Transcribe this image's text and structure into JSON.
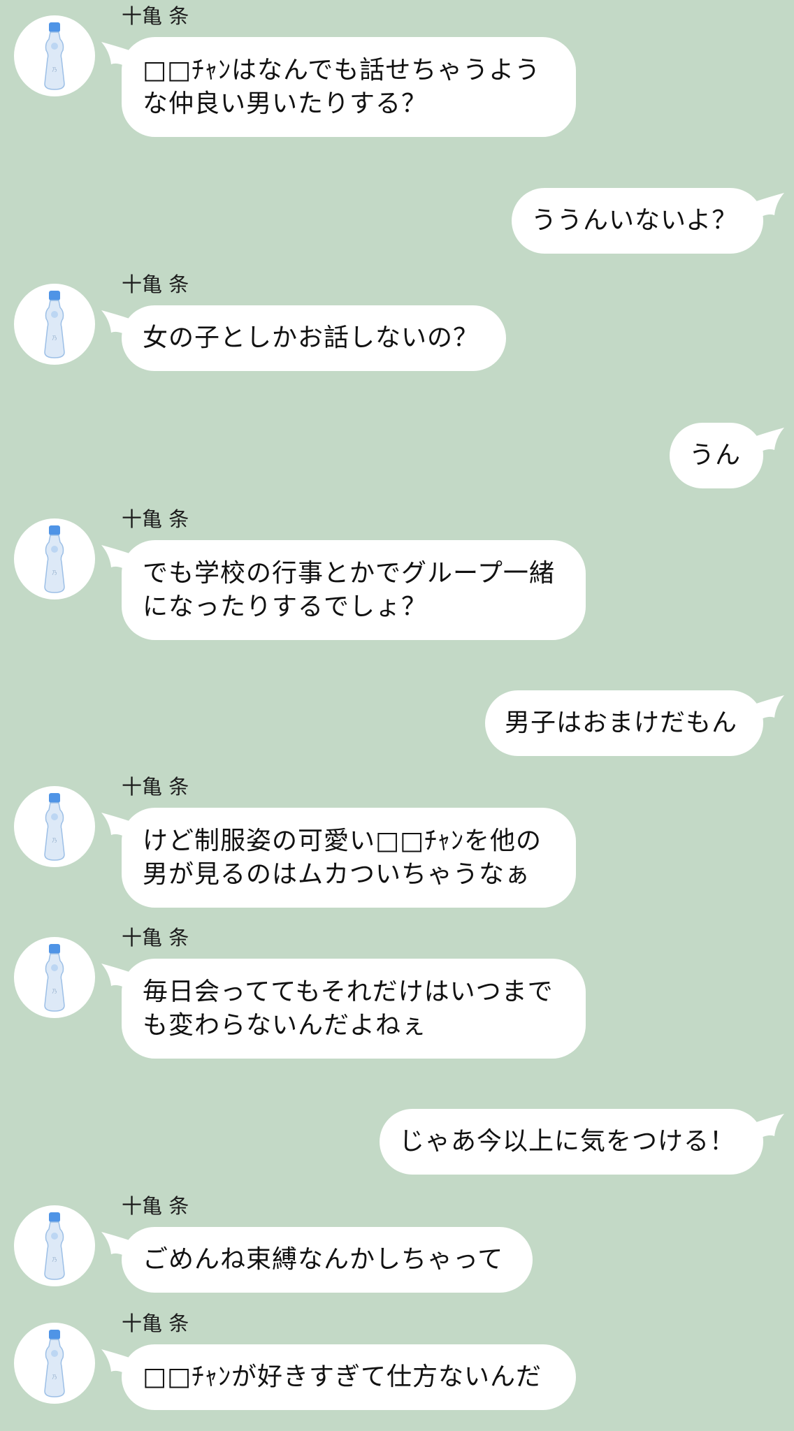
{
  "chat": {
    "contact_name": "十亀 条",
    "messages": [
      {
        "from": "them",
        "text": "□□ﾁｬﾝはなんでも話せちゃうような仲良い男いたりする？"
      },
      {
        "from": "me",
        "text": "ううんいないよ？"
      },
      {
        "from": "them",
        "text": "女の子としかお話しないの？"
      },
      {
        "from": "me",
        "text": "うん"
      },
      {
        "from": "them",
        "text": "でも学校の行事とかでグループ一緒になったりするでしょ？"
      },
      {
        "from": "me",
        "text": "男子はおまけだもん"
      },
      {
        "from": "them",
        "text": "けど制服姿の可愛い□□ﾁｬﾝを他の男が見るのはムカついちゃうなぁ"
      },
      {
        "from": "them",
        "text": "毎日会っててもそれだけはいつまでも変わらないんだよねぇ"
      },
      {
        "from": "me",
        "text": "じゃあ今以上に気をつける！"
      },
      {
        "from": "them",
        "text": "ごめんね束縛なんかしちゃって"
      },
      {
        "from": "them",
        "text": "□□ﾁｬﾝが好きすぎて仕方ないんだ"
      }
    ]
  },
  "avatar_icon": "ramune-bottle-icon",
  "colors": {
    "background": "#c3d9c6",
    "bubble": "#ffffff",
    "text": "#111111"
  }
}
